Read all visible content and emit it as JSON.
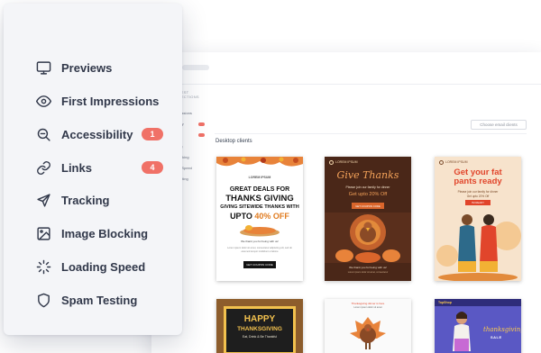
{
  "menu": {
    "items": [
      {
        "label": "Previews",
        "icon": "monitor-icon"
      },
      {
        "label": "First Impressions",
        "icon": "eye-icon"
      },
      {
        "label": "Accessibility",
        "icon": "magnifier-icon",
        "badge": "1"
      },
      {
        "label": "Links",
        "icon": "link-icon",
        "badge": "4"
      },
      {
        "label": "Tracking",
        "icon": "send-icon"
      },
      {
        "label": "Image Blocking",
        "icon": "image-icon"
      },
      {
        "label": "Loading Speed",
        "icon": "spinner-icon"
      },
      {
        "label": "Spam Testing",
        "icon": "shield-icon"
      }
    ],
    "badge_color": "#f07167",
    "text_color": "#31384a"
  },
  "app": {
    "choose_button": "Choose email clients",
    "section_title": "Desktop clients",
    "sidebar": {
      "header": "TEST SECTIONS",
      "items": [
        "s",
        "ressions",
        "ility",
        "",
        "ng",
        "ocking",
        "g Speed",
        "esting"
      ]
    },
    "previews": [
      {
        "brand": "LOREM IPSUM",
        "line1": "GREAT DEALS FOR",
        "line2": "THANKS GIVING",
        "line3": "GIVING SITEWIDE THANKS WITH",
        "line4_prefix": "UPTO",
        "line4_pct": "40% OFF",
        "note": "We thank you for being with us!",
        "body": "Lorem ipsum dolor sit amet, consectetur adipiscing elit, sed do eiusmod tempor incididunt ut labore",
        "cta": "GET COUPON CODE"
      },
      {
        "brand": "LOREM IPSUM",
        "title": "Give Thanks",
        "line1": "Please join our family for dinner",
        "line2": "Get upto 20% Off",
        "cta": "GET COUPON CODE",
        "note": "We thank you for being with us!",
        "body": "Lorem ipsum dolor sit amet, consectetur"
      },
      {
        "brand": "LOREM IPSUM",
        "title1": "Get your fat",
        "title2": "pants ready",
        "line1": "Please join our family for dinner",
        "line2": "Get upto 20% Off",
        "cta": "I'M READY"
      },
      {
        "line1": "HAPPY",
        "line2": "THANKSGIVING",
        "line3": "Eat, Drink & Be Thankful"
      },
      {
        "line1": "Thanksgiving dinner is here",
        "line2": "Lorem ipsum dolor sit amet"
      },
      {
        "logo": "TopShop",
        "title": "thanksgiving",
        "subtitle": "SALE"
      }
    ]
  }
}
